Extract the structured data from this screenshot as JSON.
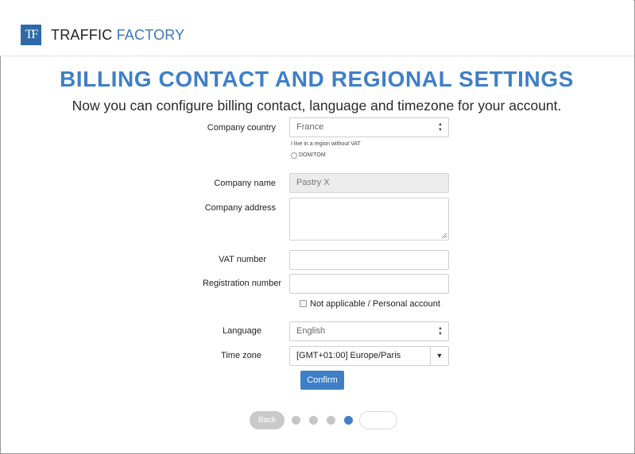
{
  "header": {
    "logo_text": "TF",
    "brand_word1": "TRAFFIC",
    "brand_word2": "FACTORY"
  },
  "page": {
    "title": "BILLING CONTACT AND REGIONAL SETTINGS",
    "subtitle": "Now you can configure billing contact, language and timezone for your account."
  },
  "form": {
    "company_country": {
      "label": "Company country",
      "value": "France"
    },
    "vat_region_note": "I live in a region without VAT",
    "dom_tom_label": "DOM/TOM",
    "company_name": {
      "label": "Company name",
      "value": "Pastry X"
    },
    "company_address": {
      "label": "Company address",
      "value": ""
    },
    "vat_number": {
      "label": "VAT number",
      "value": ""
    },
    "registration_number": {
      "label": "Registration number",
      "value": ""
    },
    "not_applicable_label": "Not applicable / Personal account",
    "language": {
      "label": "Language",
      "value": "English"
    },
    "time_zone": {
      "label": "Time zone",
      "value": "[GMT+01:00] Europe/Paris"
    },
    "confirm_label": "Confirm"
  },
  "wizard": {
    "back_label": "Back",
    "steps_total": 4,
    "current_step": 4
  },
  "icons": {
    "select_arrows": "updown-arrows-icon",
    "dropdown": "caret-down-icon"
  },
  "colors": {
    "accent": "#3f7fc8",
    "logo_bg": "#2f6aa6"
  }
}
